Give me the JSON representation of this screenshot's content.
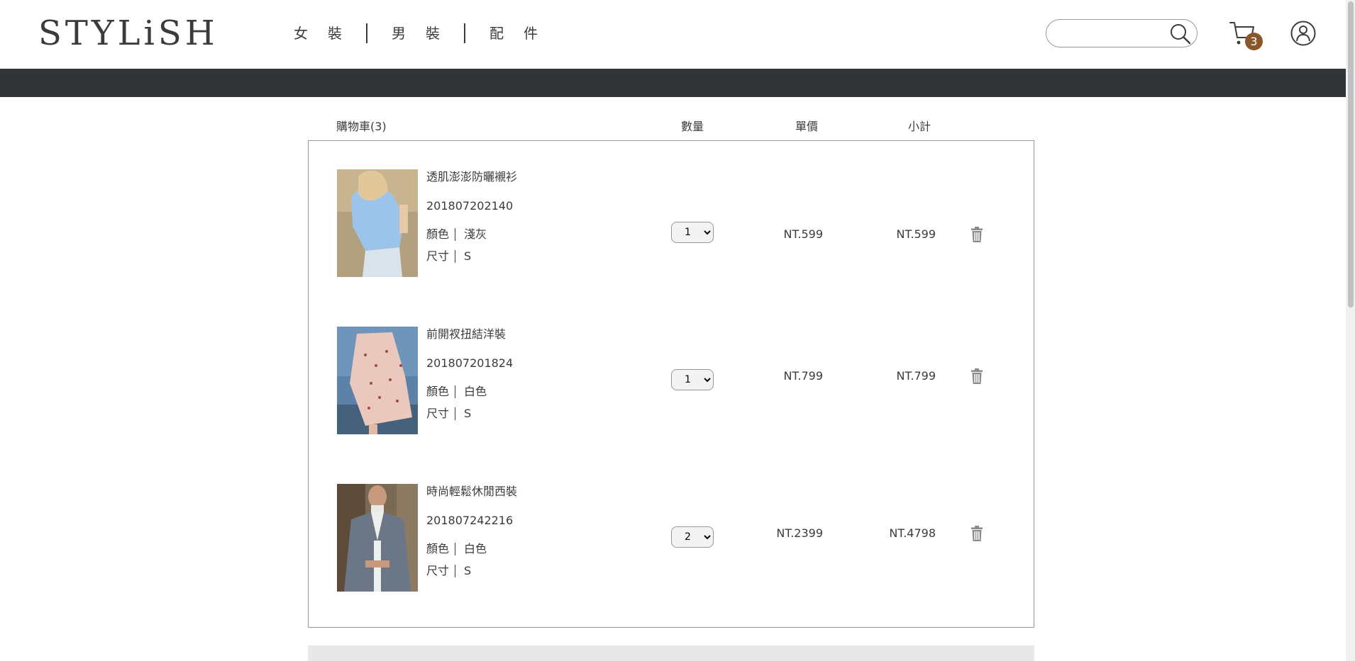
{
  "header": {
    "logo": "STYLiSH",
    "nav": [
      {
        "label": "女裝"
      },
      {
        "label": "男裝"
      },
      {
        "label": "配件"
      }
    ],
    "search": {
      "value": "",
      "placeholder": ""
    },
    "cart_count": "3"
  },
  "cart": {
    "title": "購物車(3)",
    "columns": {
      "quantity": "數量",
      "unit_price": "單價",
      "subtotal": "小計"
    },
    "items": [
      {
        "name": "透肌澎澎防曬襯衫",
        "id": "201807202140",
        "color_label": "顏色",
        "color": "淺灰",
        "size_label": "尺寸",
        "size": "S",
        "quantity": "1",
        "unit_price": "NT.599",
        "subtotal": "NT.599"
      },
      {
        "name": "前開衩扭結洋裝",
        "id": "201807201824",
        "color_label": "顏色",
        "color": "白色",
        "size_label": "尺寸",
        "size": "S",
        "quantity": "1",
        "unit_price": "NT.799",
        "subtotal": "NT.799"
      },
      {
        "name": "時尚輕鬆休閒西裝",
        "id": "201807242216",
        "color_label": "顏色",
        "color": "白色",
        "size_label": "尺寸",
        "size": "S",
        "quantity": "2",
        "unit_price": "NT.2399",
        "subtotal": "NT.4798"
      }
    ]
  },
  "colors": {
    "text": "#3f3a3a",
    "dark_bar": "#313538",
    "cart_badge": "#8b572a",
    "border": "#979797"
  },
  "icons": {
    "search": "search-icon",
    "cart": "cart-icon",
    "member": "member-icon",
    "delete": "trash-icon"
  }
}
